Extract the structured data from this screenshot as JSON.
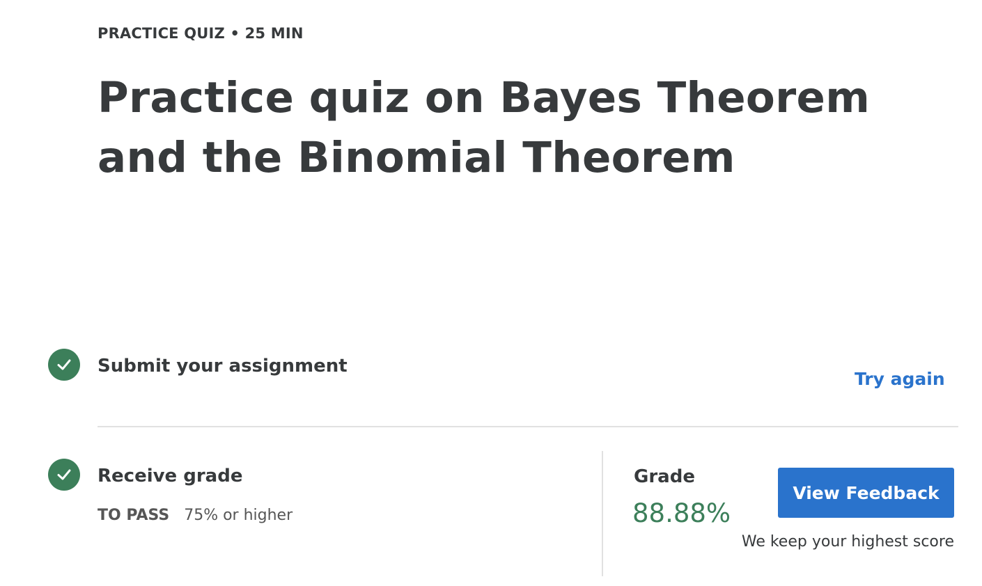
{
  "header": {
    "eyebrow": "PRACTICE QUIZ • 25 MIN",
    "title": "Practice quiz on Bayes Theorem and the Binomial Theorem"
  },
  "steps": {
    "submit": {
      "title": "Submit your assignment",
      "action_label": "Try again",
      "status_icon": "check-circle-icon"
    },
    "receive": {
      "title": "Receive grade",
      "pass_label": "TO PASS",
      "pass_value": "75% or higher",
      "status_icon": "check-circle-icon"
    }
  },
  "grade": {
    "label": "Grade",
    "value": "88.88%",
    "button_label": "View Feedback",
    "note": "We keep your highest score"
  },
  "colors": {
    "accent": "#2a73cc",
    "success": "#3c7f5a",
    "text": "#373a3c",
    "divider": "#e1e1e1"
  }
}
